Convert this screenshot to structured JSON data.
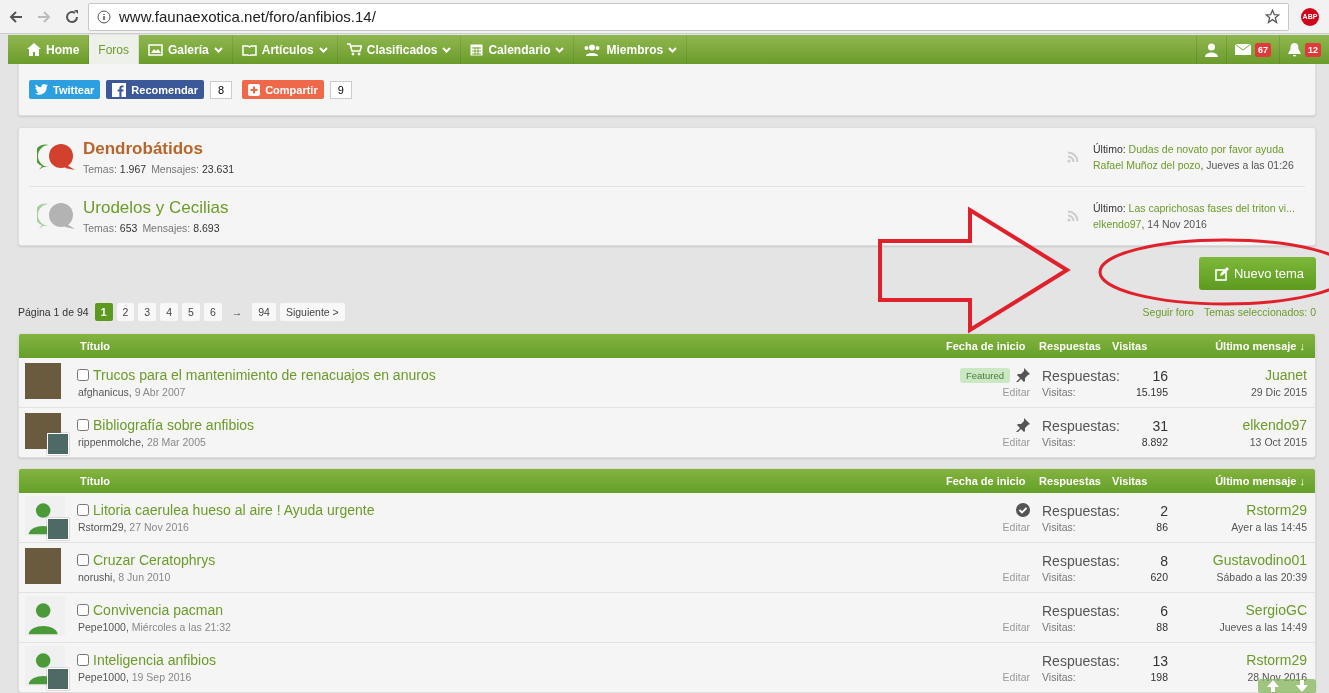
{
  "browser": {
    "url": "www.faunaexotica.net/foro/anfibios.14/",
    "addon": "ABP"
  },
  "nav": {
    "items": [
      {
        "label": "Home",
        "selected": false,
        "dropdown": false
      },
      {
        "label": "Foros",
        "selected": true,
        "dropdown": false
      },
      {
        "label": "Galería",
        "selected": false,
        "dropdown": true
      },
      {
        "label": "Artículos",
        "selected": false,
        "dropdown": true
      },
      {
        "label": "Clasificados",
        "selected": false,
        "dropdown": true
      },
      {
        "label": "Calendario",
        "selected": false,
        "dropdown": true
      },
      {
        "label": "Miembros",
        "selected": false,
        "dropdown": true
      }
    ],
    "messages_badge": "67",
    "alerts_badge": "12"
  },
  "share": [
    {
      "kind": "twitter",
      "label": "Twittear"
    },
    {
      "kind": "facebook",
      "label": "Recomendar",
      "count": "8"
    },
    {
      "kind": "google",
      "label": "Compartir",
      "count": "9"
    }
  ],
  "forums": [
    {
      "name": "Dendrobátidos",
      "unread": true,
      "stats": [
        {
          "label": "Temas:",
          "value": "1.967"
        },
        {
          "label": "Mensajes:",
          "value": "23.631"
        }
      ],
      "last_label": "Último:",
      "last_title": "Dudas de novato por favor ayuda",
      "last_user": "Rafael Muñoz del pozo",
      "last_time": ", Jueves a las 01:26"
    },
    {
      "name": "Urodelos y Cecilias",
      "unread": false,
      "stats": [
        {
          "label": "Temas:",
          "value": "653"
        },
        {
          "label": "Mensajes:",
          "value": "8.693"
        }
      ],
      "last_label": "Último:",
      "last_title": "Las caprichosas fases del triton vi...",
      "last_user": "elkendo97",
      "last_time": ", 14 Nov 2016"
    }
  ],
  "new_topic_button": "Nuevo tema",
  "pagination": {
    "label": "Página 1 de 94",
    "pages": [
      {
        "label": "1",
        "selected": true
      },
      {
        "label": "2",
        "selected": false
      },
      {
        "label": "3",
        "selected": false
      },
      {
        "label": "4",
        "selected": false
      },
      {
        "label": "5",
        "selected": false
      },
      {
        "label": "6",
        "selected": false
      }
    ],
    "gap": "→",
    "last_page": {
      "label": "94",
      "selected": false
    },
    "next": "Siguiente >"
  },
  "forum_links": [
    "Seguir foro",
    "Temas seleccionados: 0"
  ],
  "tables": [
    {
      "columns": [
        "Título",
        "Fecha de inicio",
        "Respuestas",
        "Visitas",
        "Último mensaje ↓"
      ],
      "rows": [
        {
          "avatar": {
            "kind": "photo",
            "inset": false
          },
          "checked": false,
          "title": "Trucos para el mantenimiento de renacuajos en anuros",
          "author": "afghanicus,",
          "date": "9 Abr 2007",
          "badge": "Featured",
          "pinned": true,
          "solved": false,
          "edit": "Editar",
          "replies_label": "Respuestas:",
          "replies": "16",
          "views_label": "Visitas:",
          "views": "15.195",
          "last_user": "Juanet",
          "last_date": "29 Dic 2015"
        },
        {
          "avatar": {
            "kind": "photo",
            "inset": true
          },
          "checked": false,
          "title": "Bibliografía sobre anfibios",
          "author": "rippenmolche,",
          "date": "28 Mar 2005",
          "pinned": true,
          "solved": false,
          "edit": "Editar",
          "replies_label": "Respuestas:",
          "replies": "31",
          "views_label": "Visitas:",
          "views": "8.892",
          "last_user": "elkendo97",
          "last_date": "13 Oct 2015"
        }
      ]
    },
    {
      "columns": [
        "Título",
        "Fecha de inicio",
        "Respuestas",
        "Visitas",
        "Último mensaje ↓"
      ],
      "rows": [
        {
          "avatar": {
            "kind": "silhouette",
            "inset": true
          },
          "checked": false,
          "title": "Litoria caerulea hueso al aire ! Ayuda urgente",
          "author": "Rstorm29,",
          "date": "27 Nov 2016",
          "pinned": false,
          "solved": true,
          "edit": "Editar",
          "replies_label": "Respuestas:",
          "replies": "2",
          "views_label": "Visitas:",
          "views": "86",
          "last_user": "Rstorm29",
          "last_date": "Ayer a las 14:45"
        },
        {
          "avatar": {
            "kind": "photo",
            "inset": false
          },
          "checked": false,
          "title": "Cruzar Ceratophrys",
          "author": "norushi,",
          "date": "8 Jun 2010",
          "pinned": false,
          "solved": false,
          "edit": "Editar",
          "replies_label": "Respuestas:",
          "replies": "8",
          "views_label": "Visitas:",
          "views": "620",
          "last_user": "Gustavodino01",
          "last_date": "Sábado a las 20:39"
        },
        {
          "avatar": {
            "kind": "silhouette",
            "inset": false
          },
          "checked": false,
          "title": "Convivencia pacman",
          "author": "Pepe1000,",
          "date": "Miércoles a las 21:32",
          "pinned": false,
          "solved": false,
          "edit": "Editar",
          "replies_label": "Respuestas:",
          "replies": "6",
          "views_label": "Visitas:",
          "views": "88",
          "last_user": "SergioGC",
          "last_date": "Jueves a las 14:49"
        },
        {
          "avatar": {
            "kind": "silhouette",
            "inset": true
          },
          "checked": false,
          "title": "Inteligencia anfibios",
          "author": "Pepe1000,",
          "date": "19 Sep 2016",
          "pinned": false,
          "solved": false,
          "edit": "Editar",
          "replies_label": "Respuestas:",
          "replies": "13",
          "views_label": "Visitas:",
          "views": "198",
          "last_user": "Rstorm29",
          "last_date": "28 Nov 2016"
        }
      ]
    }
  ]
}
